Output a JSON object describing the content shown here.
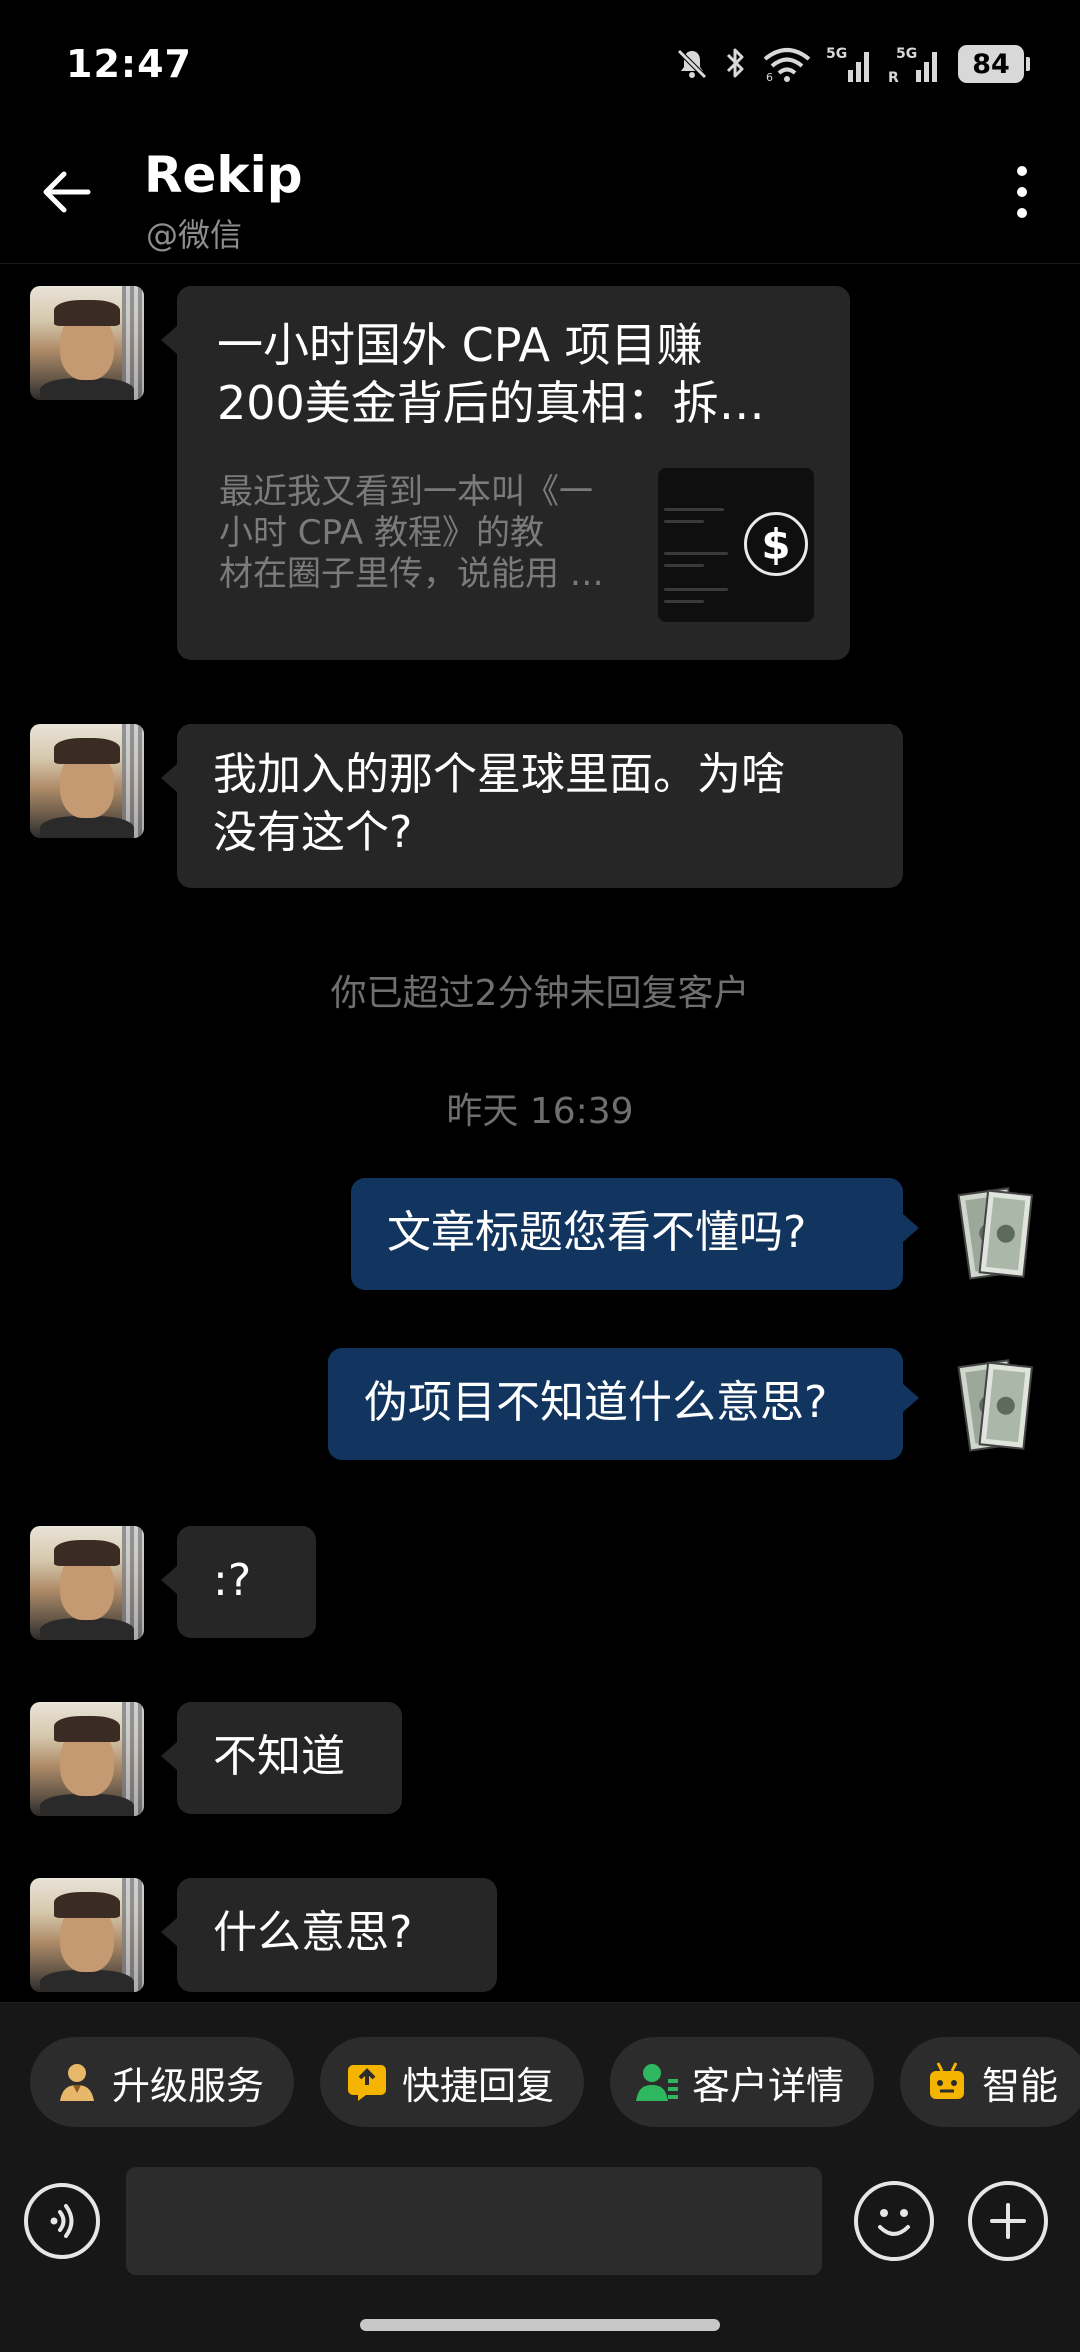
{
  "status_bar": {
    "time": "12:47",
    "battery": "84",
    "signal_labels": [
      "5G",
      "5G",
      "R",
      "6"
    ]
  },
  "header": {
    "name": "Rekip",
    "subtitle": "@微信"
  },
  "messages": {
    "link_card": {
      "title_line1": "一小时国外 CPA 项目赚",
      "title_line2": "200美金背后的真相：拆…",
      "desc_line1": "最近我又看到一本叫《一",
      "desc_line2": "小时 CPA 教程》的教",
      "desc_line3": "材在圈子里传，说能用 …",
      "thumb_symbol": "$"
    },
    "msg1_line1": "我加入的那个星球里面。为啥",
    "msg1_line2": "没有这个?",
    "system_note": "你已超过2分钟未回复客户",
    "timestamp": "昨天  16:39",
    "out1": "文章标题您看不懂吗?",
    "out2": "伪项目不知道什么意思?",
    "in2": ":?",
    "in3": "不知道",
    "in4": "什么意思?"
  },
  "chips": [
    {
      "label": "升级服务",
      "icon": "person-badge-icon",
      "color": "#e8b86a"
    },
    {
      "label": "快捷回复",
      "icon": "quick-reply-icon",
      "color": "#f5b400"
    },
    {
      "label": "客户详情",
      "icon": "customer-detail-icon",
      "color": "#2fb760"
    },
    {
      "label": "智能",
      "icon": "robot-icon",
      "color": "#f5b400"
    }
  ],
  "input": {
    "placeholder": ""
  },
  "colors": {
    "incoming_bubble": "#262626",
    "outgoing_bubble": "#11355f",
    "background": "#000000"
  }
}
